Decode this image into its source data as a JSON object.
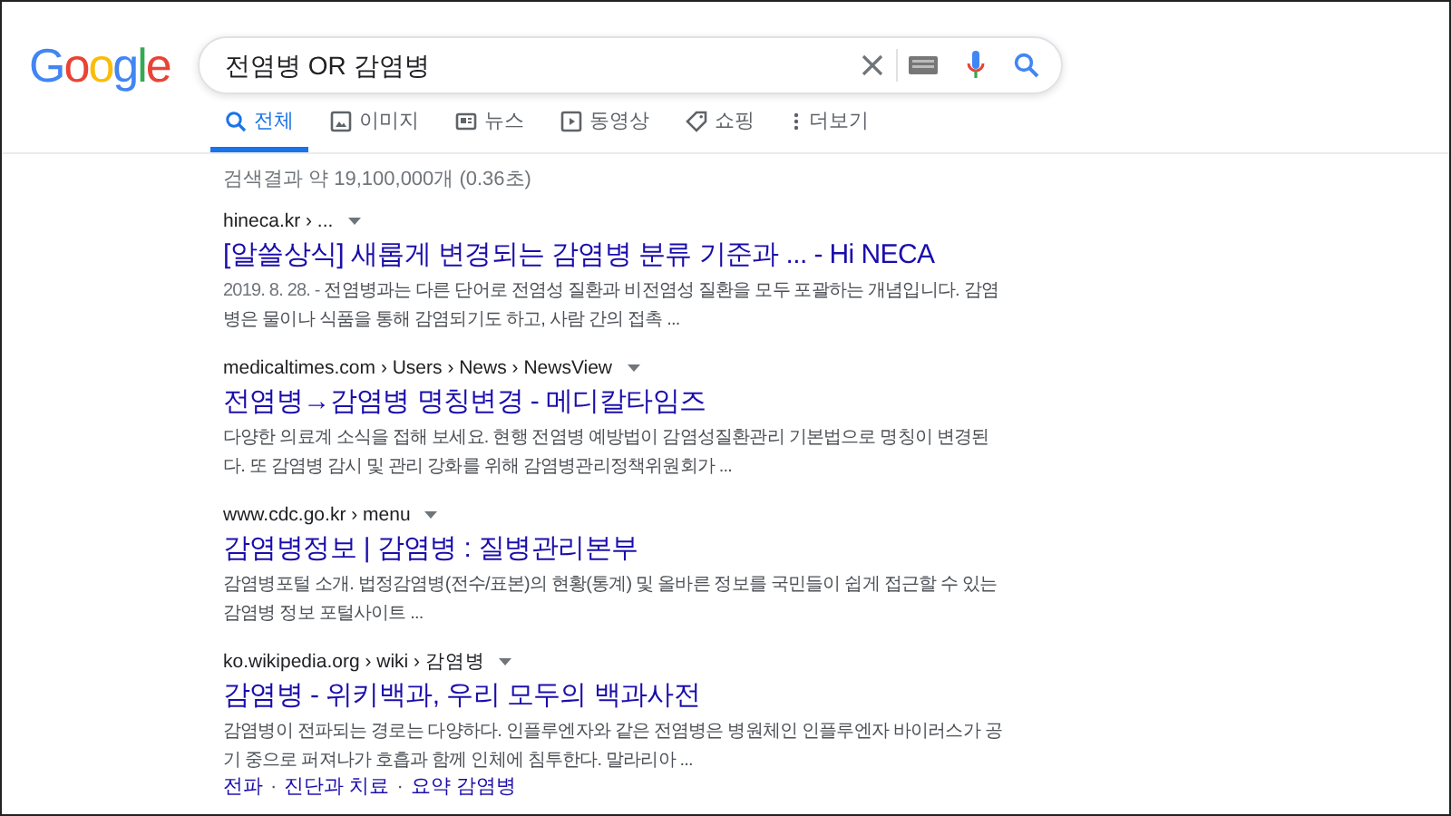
{
  "logo": "Google",
  "search": {
    "value": "전염병 OR 감염병"
  },
  "tabs": [
    {
      "label": "전체",
      "selected": true
    },
    {
      "label": "이미지",
      "selected": false
    },
    {
      "label": "뉴스",
      "selected": false
    },
    {
      "label": "동영상",
      "selected": false
    },
    {
      "label": "쇼핑",
      "selected": false
    },
    {
      "label": "더보기",
      "selected": false
    }
  ],
  "result_stats": "검색결과 약 19,100,000개 (0.36초)",
  "results": [
    {
      "url": "hineca.kr › ...",
      "title": "[알쓸상식] 새롭게 변경되는 감염병 분류 기준과 ... - Hi NECA",
      "date": "2019. 8. 28. - ",
      "snippet": "전염병과는 다른 단어로 전염성 질환과 비전염성 질환을 모두 포괄하는 개념입니다. 감염병은 물이나 식품을 통해 감염되기도 하고, 사람 간의 접촉 ..."
    },
    {
      "url": "medicaltimes.com › Users › News › NewsView",
      "title": "전염병→감염병 명칭변경 - 메디칼타임즈",
      "snippet": "다양한 의료계 소식을 접해 보세요. 현행 전염병 예방법이 감염성질환관리 기본법으로 명칭이 변경된다. 또 감염병 감시 및 관리 강화를 위해 감염병관리정책위원회가 ..."
    },
    {
      "url": "www.cdc.go.kr › menu",
      "title": "감염병정보 | 감염병 : 질병관리본부",
      "snippet": "감염병포털 소개. 법정감염병(전수/표본)의 현황(통계) 및 올바른 정보를 국민들이 쉽게 접근할 수 있는 감염병 정보 포털사이트 ..."
    },
    {
      "url": "ko.wikipedia.org › wiki › 감염병",
      "title": "감염병 - 위키백과, 우리 모두의 백과사전",
      "snippet": "감염병이 전파되는 경로는 다양하다. 인플루엔자와 같은 전염병은 병원체인 인플루엔자 바이러스가 공기 중으로 퍼져나가 호흡과 함께 인체에 침투한다. 말라리아 ...",
      "sitelinks": [
        "전파",
        "진단과 치료",
        "요약 감염병"
      ],
      "sitelink_separator": "·"
    }
  ]
}
